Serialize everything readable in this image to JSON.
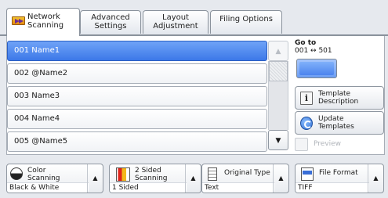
{
  "tabs": [
    {
      "line1": "Network",
      "line2": "Scanning",
      "active": true
    },
    {
      "line1": "Advanced",
      "line2": "Settings",
      "active": false
    },
    {
      "line1": "Layout",
      "line2": "Adjustment",
      "active": false
    },
    {
      "line1": "Filing Options",
      "line2": "",
      "active": false
    }
  ],
  "address_list": {
    "items": [
      {
        "label": "001  Name1",
        "selected": true
      },
      {
        "label": "002  @Name2",
        "selected": false
      },
      {
        "label": "003  Name3",
        "selected": false
      },
      {
        "label": "004  Name4",
        "selected": false
      },
      {
        "label": "005  @Name5",
        "selected": false
      }
    ],
    "scroll_up_glyph": "▲",
    "scroll_down_glyph": "▼"
  },
  "goto": {
    "label": "Go to",
    "range": "001 ↔ 501"
  },
  "side_buttons": {
    "template_description": {
      "line1": "Template",
      "line2": "Description",
      "icon": "info-icon",
      "glyph": "i"
    },
    "update_templates": {
      "line1": "Update",
      "line2": "Templates",
      "icon": "refresh-icon"
    },
    "preview": {
      "label": "Preview",
      "enabled": false
    }
  },
  "features": {
    "color_scanning": {
      "title1": "Color",
      "title2": "Scanning",
      "value": "Black & White",
      "icon": "color-mode-icon"
    },
    "two_sided": {
      "title1": "2 Sided",
      "title2": "Scanning",
      "value": "1 Sided",
      "icon": "two-sided-icon"
    },
    "original_type": {
      "title1": "Original Type",
      "title2": "",
      "value": "Text",
      "icon": "original-type-icon"
    },
    "file_format": {
      "title1": "File Format",
      "title2": "",
      "value": "TIFF",
      "icon": "file-format-icon"
    },
    "up_glyph": "▲"
  },
  "colors": {
    "selected_row": "#3c78e8",
    "background": "#e6e9ee",
    "tab_accent": "#f2a81c"
  }
}
